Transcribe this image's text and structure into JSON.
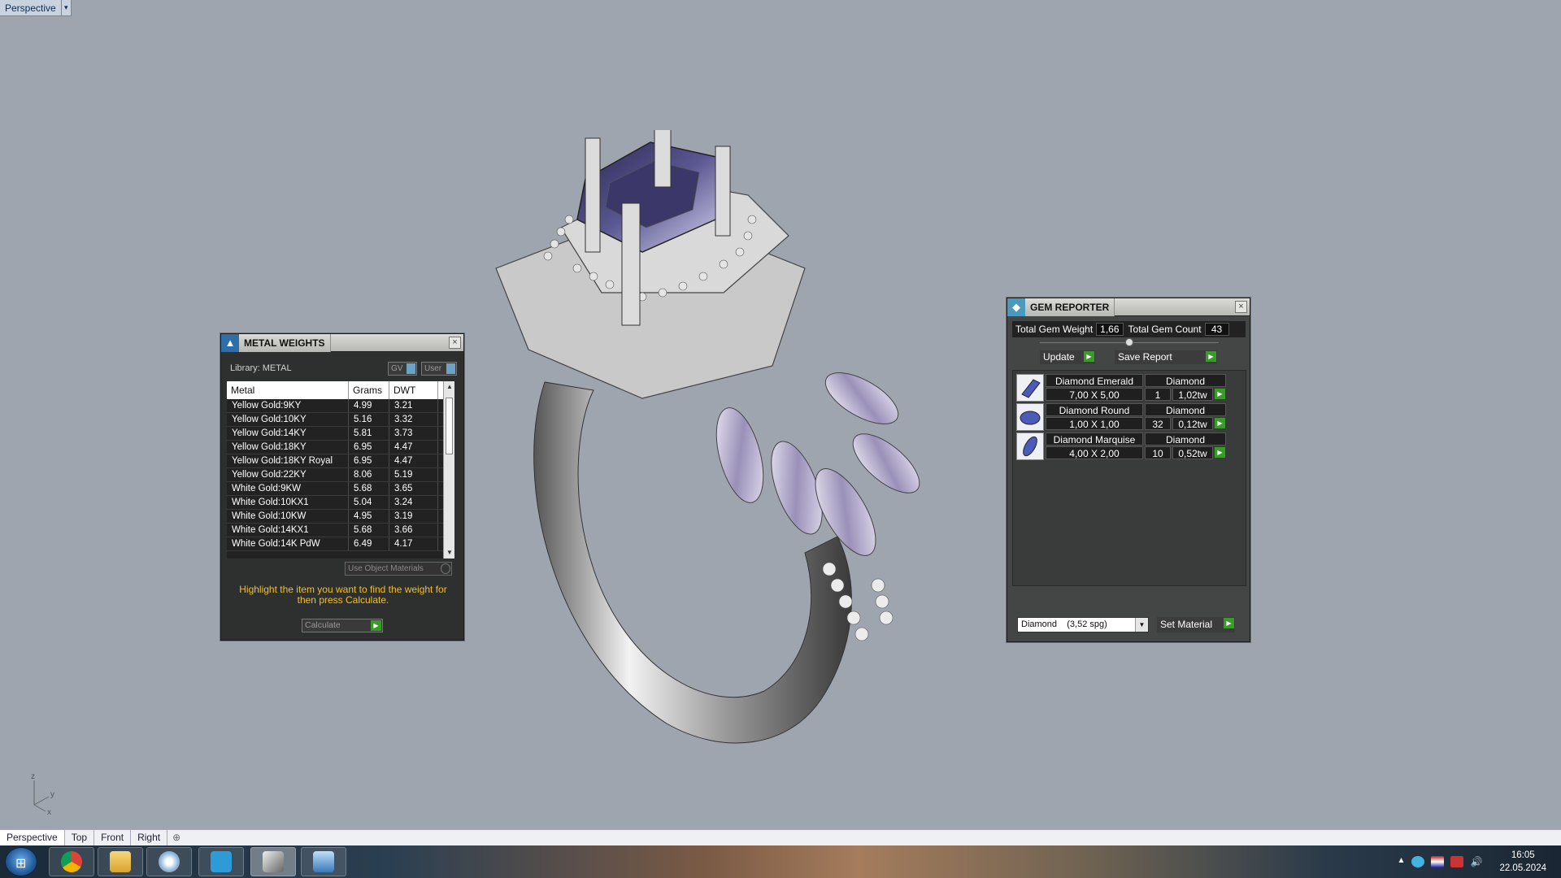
{
  "viewport": {
    "label": "Perspective",
    "dropdown_glyph": "▾"
  },
  "axes": {
    "z": "z",
    "y": "y",
    "x": "x"
  },
  "metal_weights": {
    "title": "METAL WEIGHTS",
    "library": "Library: METAL",
    "toggle_gv": "GV",
    "toggle_user": "User",
    "columns": [
      "Metal",
      "Grams",
      "DWT"
    ],
    "rows": [
      [
        "Yellow Gold:9KY",
        "4.99",
        "3.21"
      ],
      [
        "Yellow Gold:10KY",
        "5.16",
        "3.32"
      ],
      [
        "Yellow Gold:14KY",
        "5.81",
        "3.73"
      ],
      [
        "Yellow Gold:18KY",
        "6.95",
        "4.47"
      ],
      [
        "Yellow Gold:18KY Royal",
        "6.95",
        "4.47"
      ],
      [
        "Yellow Gold:22KY",
        "8.06",
        "5.19"
      ],
      [
        "White Gold:9KW",
        "5.68",
        "3.65"
      ],
      [
        "White Gold:10KX1",
        "5.04",
        "3.24"
      ],
      [
        "White Gold:10KW",
        "4.95",
        "3.19"
      ],
      [
        "White Gold:14KX1",
        "5.68",
        "3.66"
      ],
      [
        "White Gold:14K PdW",
        "6.49",
        "4.17"
      ]
    ],
    "use_object_materials": "Use Object Materials",
    "hint": "Highlight the item you want to find the weight for then press Calculate.",
    "calculate": "Calculate"
  },
  "gem_reporter": {
    "title": "GEM REPORTER",
    "total_weight_label": "Total Gem Weight",
    "total_weight_value": "1,66",
    "total_count_label": "Total Gem Count",
    "total_count_value": "43",
    "update": "Update",
    "save_report": "Save Report",
    "gems": [
      {
        "name": "Diamond Emerald",
        "material": "Diamond",
        "size": "7,00 X 5,00",
        "count": "1",
        "weight": "1,02tw"
      },
      {
        "name": "Diamond Round",
        "material": "Diamond",
        "size": "1,00 X 1,00",
        "count": "32",
        "weight": "0,12tw"
      },
      {
        "name": "Diamond Marquise",
        "material": "Diamond",
        "size": "4,00 X 2,00",
        "count": "10",
        "weight": "0,52tw"
      }
    ],
    "material_select": "Diamond    (3,52 spg)",
    "set_material": "Set Material"
  },
  "view_tabs": [
    "Perspective",
    "Top",
    "Front",
    "Right"
  ],
  "taskbar": {
    "apps": [
      "chrome-icon",
      "explorer-icon",
      "paint-icon",
      "v6-icon",
      "rhino-icon",
      "window-icon"
    ],
    "time": "16:05",
    "date": "22.05.2024"
  },
  "colors": {
    "viewport_bg": "#9fa5ae",
    "panel_bg": "#2e2f2f",
    "hint": "#f0c02a",
    "accent_green": "#3b9b2a"
  }
}
